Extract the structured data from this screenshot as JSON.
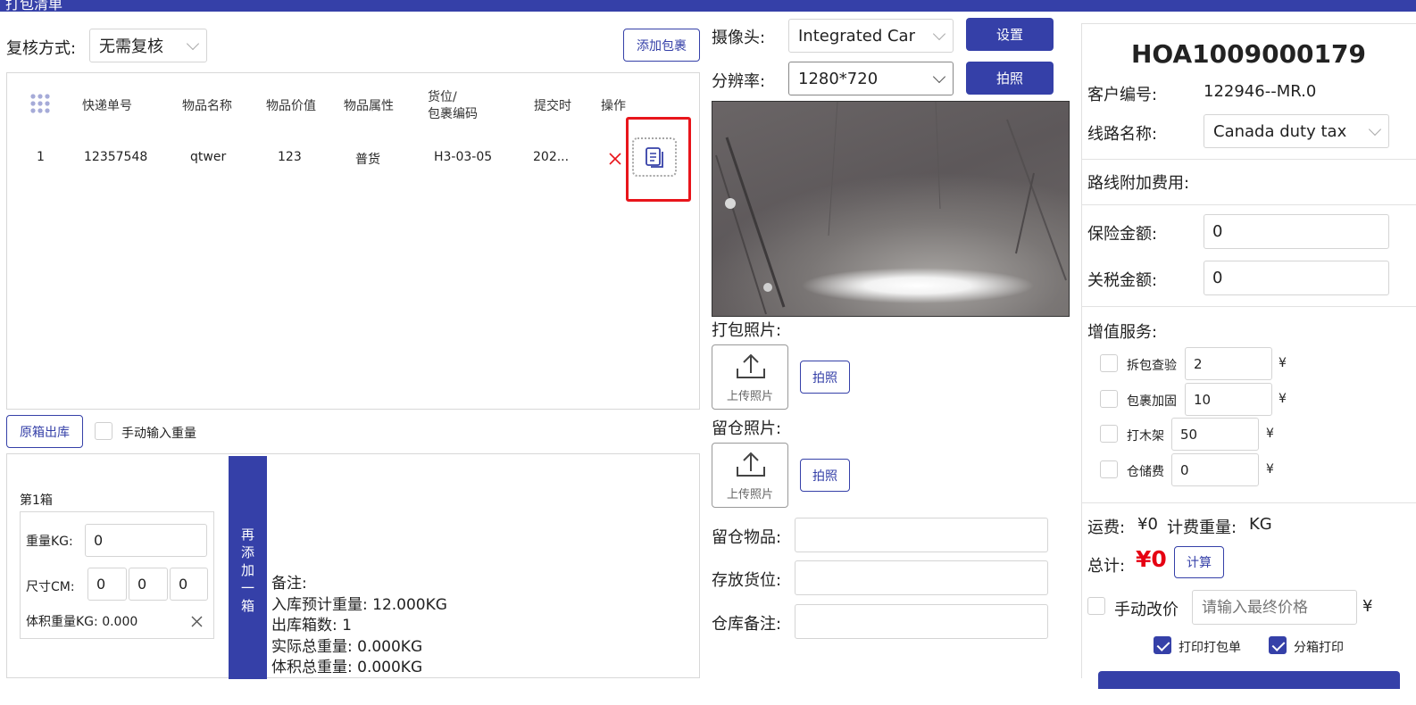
{
  "header": {
    "title": "打包清单"
  },
  "review": {
    "label": "复核方式:",
    "value": "无需复核"
  },
  "add_parcel_label": "添加包裹",
  "table": {
    "headers": [
      "快递单号",
      "物品名称",
      "物品价值",
      "物品属性",
      "货位/",
      "包裹编码",
      "提交时",
      "操作"
    ],
    "rows": [
      {
        "index": "1",
        "tracking": "12357548",
        "name": "qtwer",
        "value": "123",
        "attribute": "普货",
        "location": "H3-03-05",
        "submit_time": "202..."
      }
    ]
  },
  "original_box_label": "原箱出库",
  "manual_weight_label": "手动输入重量",
  "box": {
    "title": "第1箱",
    "weight_label": "重量KG:",
    "weight_value": "0",
    "size_label": "尺寸CM:",
    "size_values": [
      "0",
      "0",
      "0"
    ],
    "vol_weight": "体积重量KG: 0.000"
  },
  "add_box_label": "再添加一箱",
  "summary": {
    "note": "备注:",
    "expected_weight": "入库预计重量: 12.000KG",
    "box_count": "出库箱数: 1",
    "actual_weight": "实际总重量: 0.000KG",
    "vol_total": "体积总重量: 0.000KG"
  },
  "camera": {
    "label": "摄像头:",
    "value": "Integrated Car",
    "settings_label": "设置",
    "resolution_label": "分辨率:",
    "resolution_value": "1280*720",
    "capture_label": "拍照"
  },
  "pack_photo": {
    "label": "打包照片:",
    "upload_label": "上传照片",
    "capture_label": "拍照"
  },
  "warehouse_photo": {
    "label": "留仓照片:",
    "upload_label": "上传照片",
    "capture_label": "拍照"
  },
  "kept_items_label": "留仓物品:",
  "storage_location_label": "存放货位:",
  "warehouse_note_label": "仓库备注:",
  "order": {
    "code": "HOA1009000179",
    "customer_label": "客户编号:",
    "customer_value": "122946--MR.0",
    "route_label": "线路名称:",
    "route_value": "Canada duty tax",
    "route_fee_label": "路线附加费用:",
    "insurance_label": "保险金额:",
    "insurance_value": "0",
    "tax_label": "关税金额:",
    "tax_value": "0"
  },
  "services": {
    "label": "增值服务:",
    "currency": "¥",
    "items": [
      {
        "name": "拆包查验",
        "value": "2"
      },
      {
        "name": "包裹加固",
        "value": "10"
      },
      {
        "name": "打木架",
        "value": "50"
      },
      {
        "name": "仓储费",
        "value": "0"
      }
    ]
  },
  "fees": {
    "freight_label": "运费:",
    "freight_value": "¥0",
    "billing_weight_label": "计费重量:",
    "billing_weight_value": "KG",
    "total_label": "总计:",
    "total_value": "¥0",
    "calc_label": "计算"
  },
  "manual_price": {
    "label": "手动改价",
    "placeholder": "请输入最终价格",
    "currency": "¥"
  },
  "print": {
    "packing_list_label": "打印打包单",
    "split_box_label": "分箱打印"
  },
  "colors": {
    "primary": "#3540a8",
    "highlight": "#e8151b",
    "total": "#e60012"
  }
}
